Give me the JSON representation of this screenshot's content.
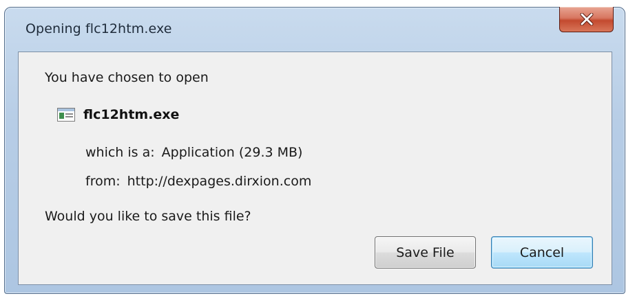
{
  "dialog": {
    "title": "Opening flc12htm.exe",
    "close_icon": "close-x-icon"
  },
  "content": {
    "intro": "You have chosen to open",
    "file_icon": "executable-file-icon",
    "file_name": "flc12htm.exe",
    "type_label": "which is a:",
    "type_value": "Application (29.3 MB)",
    "from_label": "from:",
    "from_value": "http://dexpages.dirxion.com",
    "question": "Would you like to save this file?"
  },
  "buttons": {
    "save_label": "Save File",
    "cancel_label": "Cancel"
  },
  "colors": {
    "frame": "#b7cde6",
    "client_bg": "#f0f0f0",
    "close_button": "#c34a2f",
    "default_button_border": "#3c7fb1"
  }
}
